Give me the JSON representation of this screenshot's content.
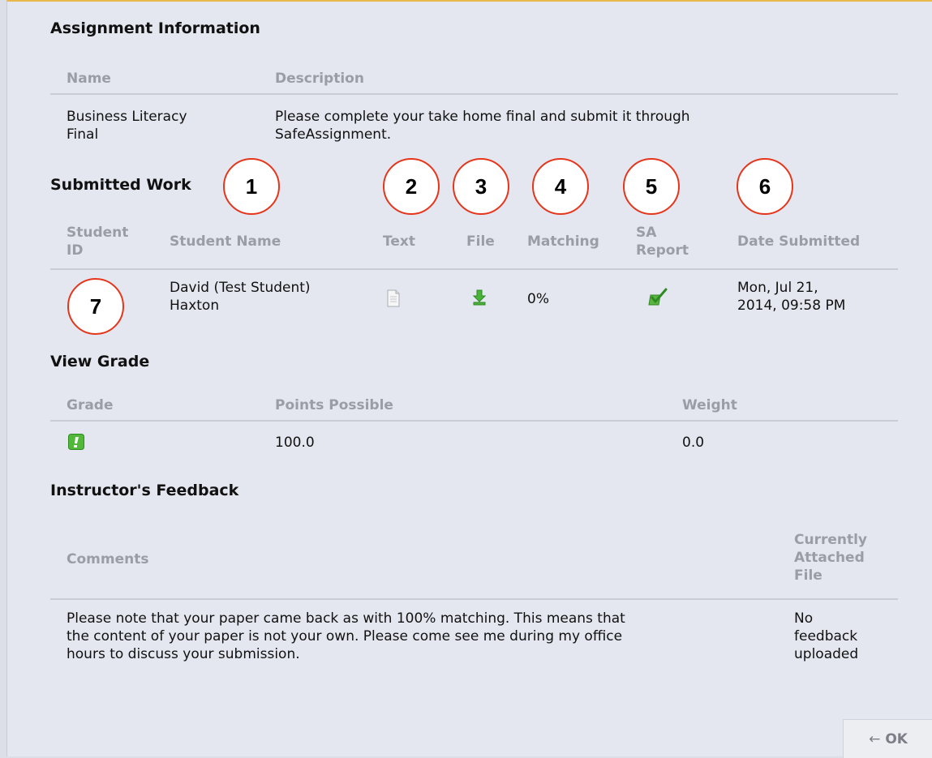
{
  "assignment_info": {
    "heading": "Assignment Information",
    "col_name": "Name",
    "col_description": "Description",
    "name_line1": "Business Literacy",
    "name_line2": "Final",
    "description_line1": "Please complete your take home final and submit it through",
    "description_line2": "SafeAssignment."
  },
  "submitted_work": {
    "heading": "Submitted Work",
    "col_student_id_line1": "Student",
    "col_student_id_line2": "ID",
    "col_student_name": "Student Name",
    "col_text": "Text",
    "col_file": "File",
    "col_matching": "Matching",
    "col_sa_report_line1": "SA",
    "col_sa_report_line2": "Report",
    "col_date_submitted": "Date Submitted",
    "row": {
      "student_id": "",
      "student_name_line1": "David (Test Student)",
      "student_name_line2": "Haxton",
      "text_icon": "document-icon",
      "file_icon": "download-icon",
      "matching": "0%",
      "sa_report_icon": "checkmark-report-icon",
      "date_line1": "Mon, Jul 21,",
      "date_line2": "2014, 09:58 PM"
    }
  },
  "view_grade": {
    "heading": "View Grade",
    "col_grade": "Grade",
    "col_points_possible": "Points Possible",
    "col_weight": "Weight",
    "grade_icon": "needs-grading-icon",
    "points_possible": "100.0",
    "weight": "0.0"
  },
  "instructor_feedback": {
    "heading": "Instructor's Feedback",
    "col_comments": "Comments",
    "col_attached_line1": "Currently",
    "col_attached_line2": "Attached",
    "col_attached_line3": "File",
    "comment_line1": "Please note that your paper came back as with 100% matching. This means that",
    "comment_line2": "the content of your paper is not your own. Please come see me during my office",
    "comment_line3": "hours to discuss your submission.",
    "attached_line1": "No",
    "attached_line2": "feedback",
    "attached_line3": "uploaded"
  },
  "callouts": [
    "1",
    "2",
    "3",
    "4",
    "5",
    "6",
    "7"
  ],
  "ok_button": {
    "arrow": "←",
    "label": "OK"
  },
  "colors": {
    "callout_border": "#e5351b",
    "accent_top": "#e8b84a",
    "icon_green": "#3aa52a"
  }
}
